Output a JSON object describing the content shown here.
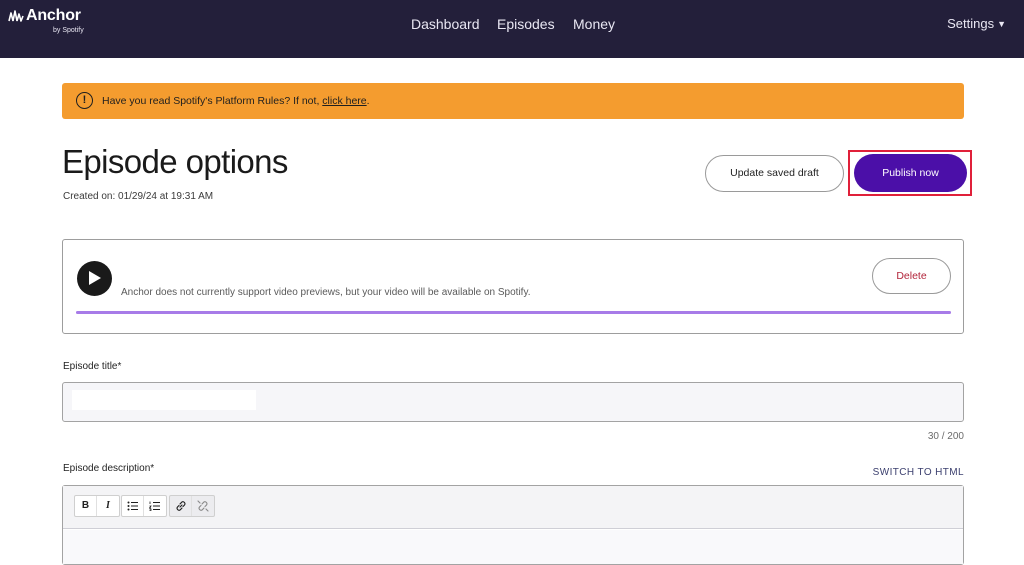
{
  "brand": {
    "name": "Anchor",
    "sub": "by Spotify"
  },
  "nav": {
    "items": [
      "Dashboard",
      "Episodes",
      "Money"
    ],
    "settings": "Settings"
  },
  "alert": {
    "text": "Have you read Spotify's Platform Rules? If not, ",
    "link": "click here",
    "suffix": "."
  },
  "page": {
    "title": "Episode options",
    "created": "Created on: 01/29/24 at 19:31 AM"
  },
  "actions": {
    "draft": "Update saved draft",
    "publish": "Publish now"
  },
  "media": {
    "note": "Anchor does not currently support video previews, but your video will be available on Spotify.",
    "delete": "Delete",
    "progress": 1.0
  },
  "form": {
    "title_label": "Episode title*",
    "title_value": "",
    "char_count": "30 / 200",
    "description_label": "Episode description*",
    "switch_html": "SWITCH TO HTML",
    "toolbar": {
      "bold": "B",
      "italic": "I"
    }
  },
  "colors": {
    "nav_bg": "#231f3a",
    "alert": "#f49c2f",
    "publish": "#4b0fa8",
    "highlight": "#e0203a",
    "progress": "#a77be8"
  }
}
